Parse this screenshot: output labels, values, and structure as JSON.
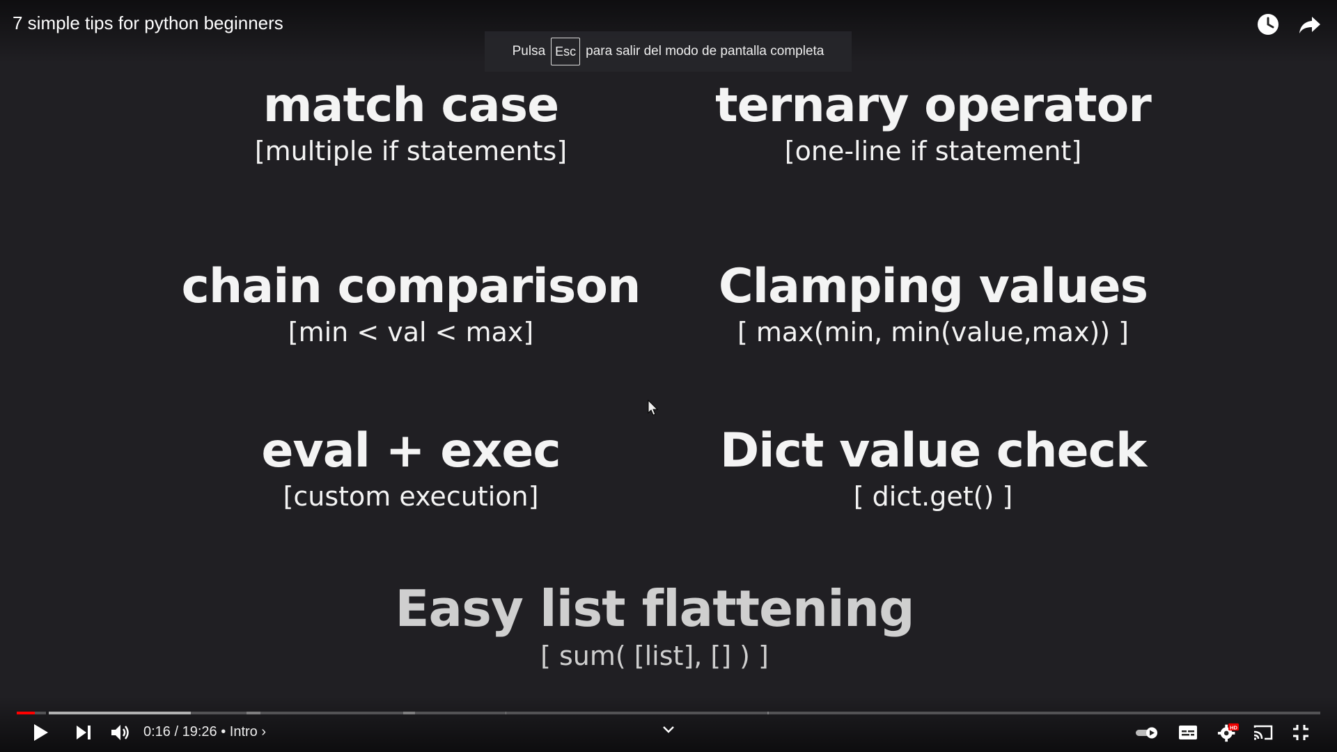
{
  "video": {
    "title": "7 simple tips for python beginners"
  },
  "fullscreen_toast": {
    "before": "Pulsa",
    "key": "Esc",
    "after": "para salir del modo de pantalla completa"
  },
  "tips": [
    {
      "heading": "match case",
      "sub": "[multiple if statements]"
    },
    {
      "heading": "ternary operator",
      "sub": "[one-line if statement]"
    },
    {
      "heading": "chain comparison",
      "sub": "[min < val < max]"
    },
    {
      "heading": "Clamping values",
      "sub": "[ max(min, min(value,max)) ]"
    },
    {
      "heading": "eval + exec",
      "sub": "[custom execution]"
    },
    {
      "heading": "Dict value check",
      "sub": "[ dict.get() ]"
    },
    {
      "heading": "Easy list flattening",
      "sub": "[ sum( [list], [] ) ]"
    }
  ],
  "player": {
    "time_current": "0:16",
    "time_total": "19:26",
    "chapter": "Intro",
    "time_display": "0:16 / 19:26 • Intro ›",
    "progress_fraction": 0.0137,
    "accent_color": "#ff0000",
    "hd_badge": "HD"
  },
  "icons": {
    "watch_later": "clock-icon",
    "share": "share-arrow-icon",
    "play": "play-icon",
    "next": "next-icon",
    "volume": "volume-icon",
    "chapters": "chevron-down-icon",
    "autoplay": "autoplay-toggle-icon",
    "subtitles": "subtitles-icon",
    "settings": "settings-gear-icon",
    "cast": "cast-icon",
    "exit_fullscreen": "exit-fullscreen-icon"
  }
}
